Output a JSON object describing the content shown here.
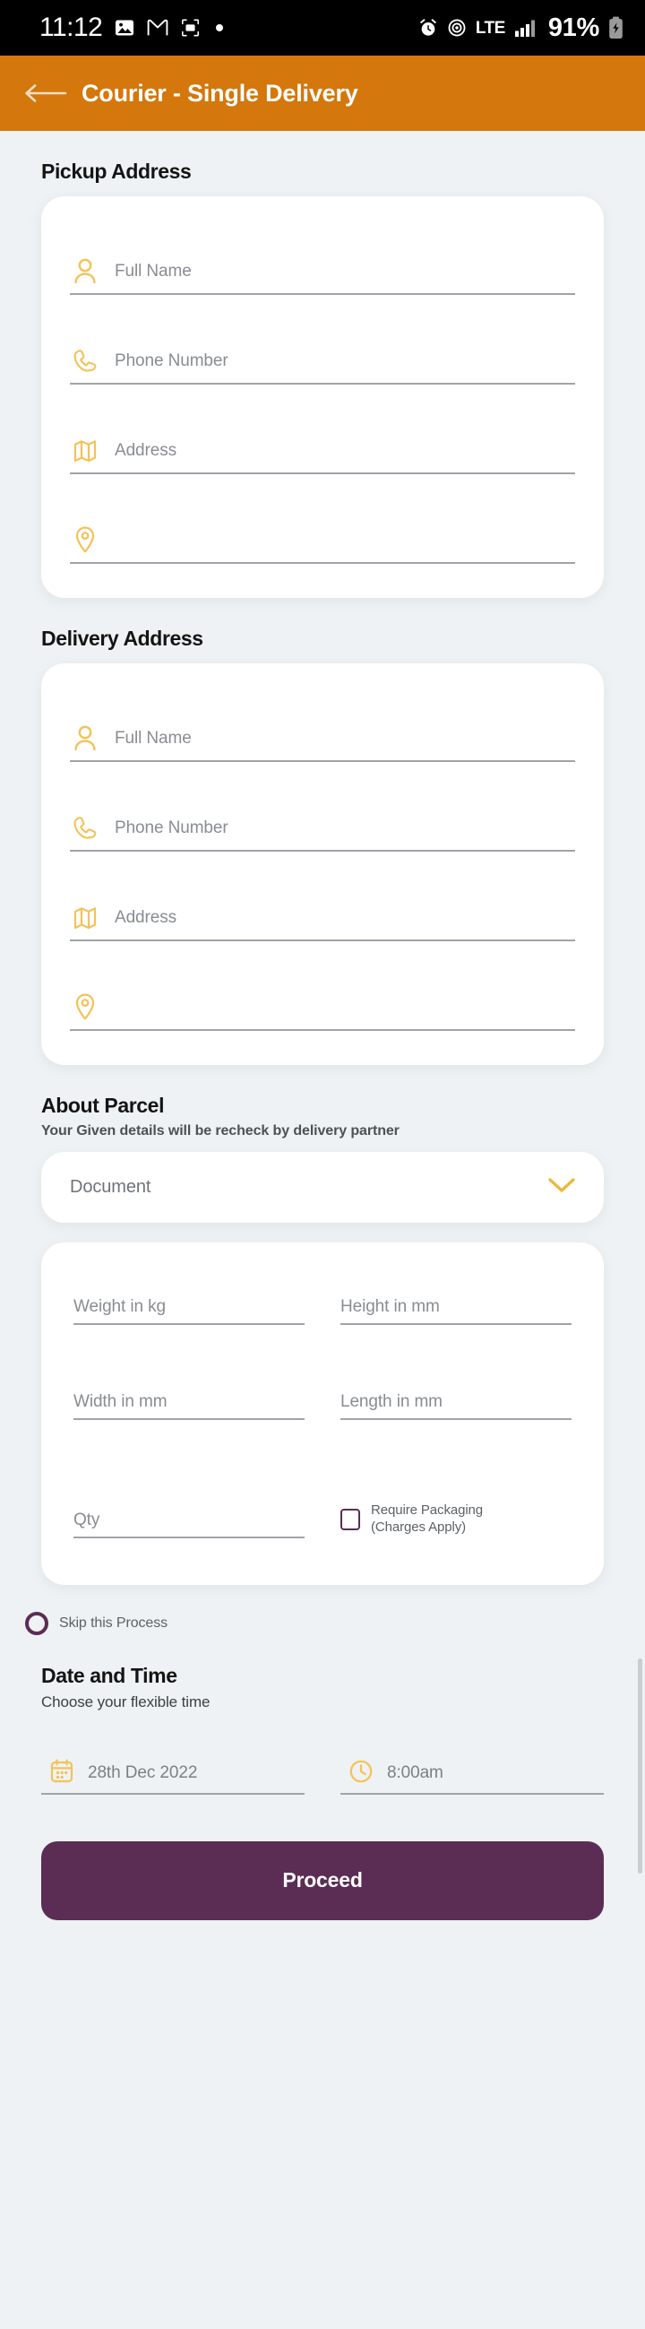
{
  "status_bar": {
    "time": "11:12",
    "network_label": "LTE",
    "battery_percent": "91%",
    "icons": [
      "photo-icon",
      "gmail-icon",
      "screenshot-icon",
      "dot-icon",
      "alarm-icon",
      "hotspot-icon",
      "signal-icon",
      "battery-charging-icon"
    ]
  },
  "app_bar": {
    "back_label": "back-arrow-icon",
    "title": "Courier - Single Delivery",
    "background_color": "#d4770c"
  },
  "pickup": {
    "title": "Pickup Address",
    "fields": [
      {
        "icon": "person-icon",
        "placeholder": "Full Name"
      },
      {
        "icon": "phone-icon",
        "placeholder": "Phone Number"
      },
      {
        "icon": "map-icon",
        "placeholder": "Address"
      },
      {
        "icon": "location-pin-icon",
        "placeholder": ""
      }
    ]
  },
  "delivery": {
    "title": "Delivery Address",
    "fields": [
      {
        "icon": "person-icon",
        "placeholder": "Full Name"
      },
      {
        "icon": "phone-icon",
        "placeholder": "Phone Number"
      },
      {
        "icon": "map-icon",
        "placeholder": "Address"
      },
      {
        "icon": "location-pin-icon",
        "placeholder": ""
      }
    ]
  },
  "parcel": {
    "title": "About Parcel",
    "subtitle": "Your Given details will be recheck by delivery partner",
    "type_select": {
      "value": "Document",
      "chevron": "chevron-down-icon"
    },
    "measurements": [
      {
        "placeholder": "Weight in kg"
      },
      {
        "placeholder": "Height in mm"
      },
      {
        "placeholder": "Width in mm"
      },
      {
        "placeholder": "Length in mm"
      },
      {
        "placeholder": "Qty"
      }
    ],
    "packaging_checkbox": {
      "line1": "Require Packaging",
      "line2": "(Charges Apply)",
      "checked": false
    }
  },
  "skip": {
    "label": "Skip this Process",
    "selected": false
  },
  "date_time": {
    "title": "Date and Time",
    "subtitle": "Choose your flexible time",
    "date": {
      "icon": "calendar-icon",
      "value": "28th Dec 2022"
    },
    "time": {
      "icon": "clock-icon",
      "value": "8:00am"
    }
  },
  "footer": {
    "proceed_label": "Proceed",
    "proceed_color": "#5b2d54"
  },
  "theme": {
    "accent_orange": "#d4770c",
    "icon_amber": "#f4c258",
    "purple": "#5b2d54",
    "page_bg": "#eef2f4"
  }
}
